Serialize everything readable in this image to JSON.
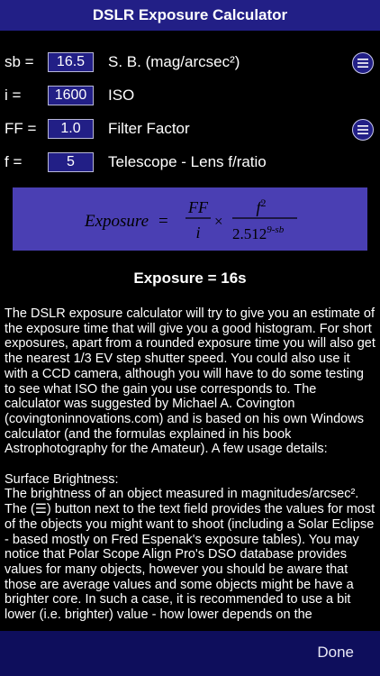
{
  "header": {
    "title": "DSLR Exposure Calculator"
  },
  "inputs": [
    {
      "symbol": "sb =",
      "value": "16.5",
      "label": "S. B. (mag/arcsec²)",
      "has_list_button": true
    },
    {
      "symbol": "i =",
      "value": "1600",
      "label": "ISO",
      "has_list_button": false
    },
    {
      "symbol": "FF =",
      "value": "1.0",
      "label": "Filter Factor",
      "has_list_button": true
    },
    {
      "symbol": "f =",
      "value": "5",
      "label": "Telescope - Lens f/ratio",
      "has_list_button": false
    }
  ],
  "formula": {
    "lhs": "Exposure",
    "eq": "=",
    "frac1_num": "FF",
    "frac1_den": "i",
    "times": "×",
    "frac2_num": "f",
    "frac2_num_exp": "2",
    "frac2_den_base": "2.512",
    "frac2_den_exp": "9-sb"
  },
  "result": {
    "text": "Exposure = 16s"
  },
  "description": {
    "paragraph1": "The DSLR exposure calculator will try to give you an estimate of the exposure time that will give you a good histogram. For short exposures, apart from a rounded exposure time you will also get the nearest 1/3 EV step shutter speed. You could also use it with a CCD camera, although you will have to do some testing to see what ISO the gain you use corresponds to. The calculator was suggested by Michael A. Covington (covingtoninnovations.com) and is based on his own Windows calculator (and the formulas explained in his book Astrophotography for the Amateur). A few usage details:",
    "heading2": "Surface Brightness:",
    "paragraph2": "The brightness of an object measured in magnitudes/arcsec². The (☰) button next to the text field provides the values for most of the objects you might want to shoot (including a Solar Eclipse - based mostly on Fred Espenak's exposure tables). You may notice that Polar Scope Align Pro's DSO database provides values for many objects, however you should be aware that those are average values and some objects might be have a brighter core. In such a case, it is recommended to use a bit lower (i.e. brighter) value - how lower depends on the"
  },
  "footer": {
    "done_label": "Done"
  },
  "colors": {
    "accent": "#221f86",
    "formula_bg": "#4a3fb3",
    "footer_bg": "#0e0e5c"
  }
}
